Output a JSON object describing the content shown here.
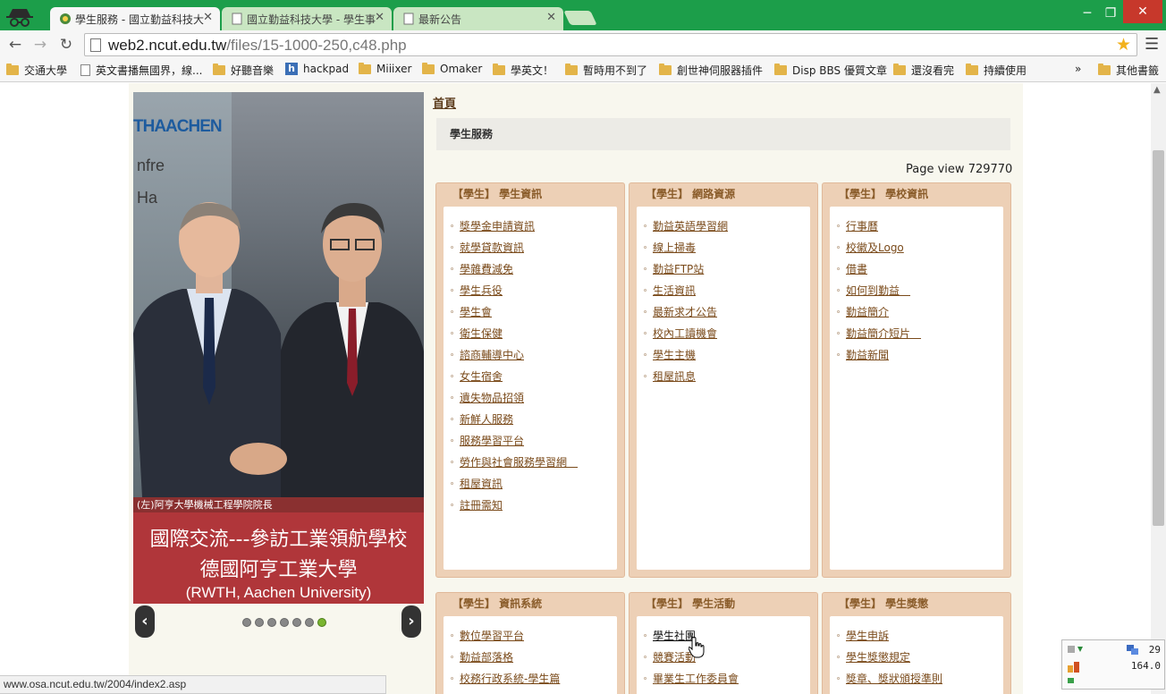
{
  "browser": {
    "tabs": [
      {
        "title": "學生服務 - 國立勤益科技大"
      },
      {
        "title": "國立勤益科技大學 - 學生事"
      },
      {
        "title": "最新公告"
      }
    ],
    "url_host": "web2.ncut.edu.tw",
    "url_path": "/files/15-1000-250,c48.php",
    "bookmarks": [
      "交通大學",
      "英文書播無國界，線...",
      "好聽音樂",
      "hackpad",
      "Miiixer",
      "Omaker",
      "學英文！",
      "暫時用不到了",
      "創世神伺服器插件",
      "Disp BBS 優質文章",
      "還沒看完",
      "持續使用"
    ],
    "bookmarks_more": "»",
    "other_bookmarks": "其他書籤",
    "status_url": "www.osa.ncut.edu.tw/2004/index2.asp"
  },
  "page": {
    "breadcrumb": "首頁",
    "section_title": "學生服務",
    "page_view_label": "Page view",
    "page_view_count": "729770"
  },
  "slideshow": {
    "sign_brand": "THAACHEN",
    "sign_text_1": "nfre",
    "sign_text_2": "Ha",
    "caption": "(左)阿亨大學機械工程學院院長",
    "banner_line1": "國際交流---參訪工業領航學校",
    "banner_line2": "德國阿亨工業大學",
    "banner_line3": "(RWTH, Aachen University)",
    "prev": "‹",
    "next": "›",
    "dot_count": 7,
    "active_dot": 7
  },
  "boxes": [
    {
      "title": "【學生】 學生資訊",
      "links": [
        "獎學金申請資訊",
        "就學貸款資訊",
        "學雜費減免",
        "學生兵役",
        "學生會",
        "衛生保健",
        "諮商輔導中心",
        "女生宿舍",
        "遺失物品招領",
        "新鮮人服務",
        "服務學習平台",
        "勞作與社會服務學習網　",
        "租屋資訊",
        "註冊需知"
      ]
    },
    {
      "title": "【學生】 網路資源",
      "links": [
        "勤益英語學習網",
        "線上掃毒",
        "勤益FTP站",
        "生活資訊",
        "最新求才公告",
        "校內工讀機會",
        "學生主機",
        "租屋訊息"
      ]
    },
    {
      "title": "【學生】 學校資訊",
      "links": [
        "行事曆",
        "校徽及Logo",
        "借書",
        "如何到勤益　",
        "勤益簡介",
        "勤益簡介短片　",
        "勤益新聞"
      ]
    },
    {
      "title": "【學生】 資訊系統",
      "links": [
        "數位學習平台",
        "勤益部落格",
        "校務行政系統-學生篇"
      ]
    },
    {
      "title": "【學生】 學生活動",
      "links": [
        "學生社團",
        "競賽活動",
        "畢業生工作委員會"
      ]
    },
    {
      "title": "【學生】 學生獎懲",
      "links": [
        "學生申訴",
        "學生獎懲規定",
        "獎章、獎狀頒授準則"
      ]
    }
  ],
  "tray": {
    "value1": "29",
    "value2": "164.0"
  }
}
